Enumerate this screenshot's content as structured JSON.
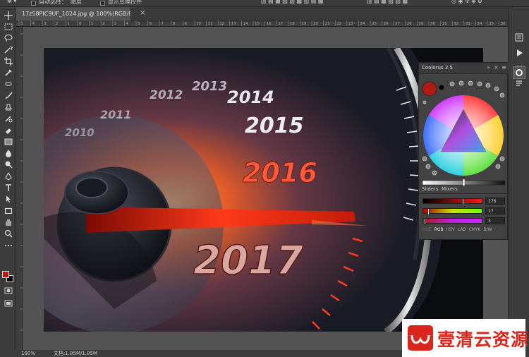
{
  "options_bar": {
    "auto_select_label": "自动选择：",
    "layer_value": "图层",
    "show_transform_label": "显示变换控件"
  },
  "document": {
    "tab_title": "17z58PIC9UF_1024.jpg @ 100%(RGB/8#) *",
    "close_glyph": "×",
    "zoom": "100%",
    "doc_info": "文档:1.85M/1.85M"
  },
  "ruler_top_ticks": [
    "5",
    "4",
    "3",
    "2",
    "1",
    "0",
    "1",
    "2",
    "3",
    "4",
    "5",
    "6",
    "7",
    "8",
    "9",
    "10",
    "11",
    "12",
    "13",
    "14",
    "15",
    "16",
    "17",
    "18",
    "19",
    "20",
    "21",
    "22",
    "23",
    "24",
    "25",
    "26",
    "27",
    "28",
    "29",
    "30",
    "31",
    "32",
    "33",
    "34",
    "35",
    "36"
  ],
  "tools": [
    "move-icon",
    "marquee-icon",
    "lasso-icon",
    "magic-wand-icon",
    "crop-icon",
    "eyedropper-icon",
    "healing-icon",
    "brush-icon",
    "stamp-icon",
    "history-brush-icon",
    "eraser-icon",
    "gradient-icon",
    "blur-icon",
    "dodge-icon",
    "pen-icon",
    "type-icon",
    "path-select-icon",
    "rectangle-icon",
    "hand-icon",
    "zoom-icon",
    "more-tools-icon"
  ],
  "colors": {
    "foreground": "#b01b14",
    "background": "#000000",
    "current_color": "#b01b14"
  },
  "dock": {
    "buttons": [
      "history-icon",
      "play-icon",
      "character-icon",
      "paragraph-icon",
      "coolorus-icon"
    ],
    "character_label": "A|"
  },
  "canvas_image": {
    "years": [
      "2010",
      "2011",
      "2012",
      "2013",
      "2014",
      "2015",
      "2016",
      "2017"
    ]
  },
  "coolorus": {
    "title": "Coolorus 2.5",
    "menu_glyph": "≡",
    "collapse_glyph": "»",
    "close_glyph": "×",
    "tabs": [
      "Sliders",
      "Mixers"
    ],
    "sliders": [
      {
        "value": "176",
        "level": 0.69,
        "gradient": "linear-gradient(90deg,#000,#ff1a10)"
      },
      {
        "value": "17",
        "level": 0.07,
        "gradient": "linear-gradient(90deg,#b00000,#c6e400,#6dff00)"
      },
      {
        "value": "3",
        "level": 0.01,
        "gradient": "linear-gradient(90deg,#b01b14,#c21ee8,#d028ff)"
      }
    ],
    "modes": [
      "HUE",
      "RGB",
      "HSV",
      "LAB",
      "CMYK",
      "B/W"
    ]
  },
  "watermark": {
    "text": "壹清云资源"
  }
}
